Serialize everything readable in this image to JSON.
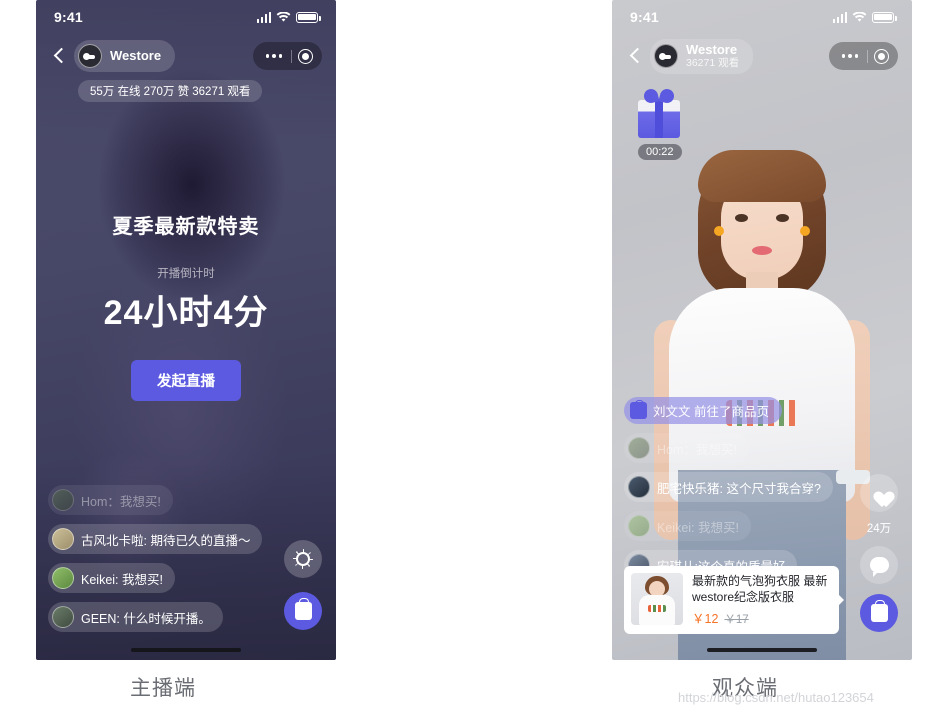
{
  "host": {
    "caption": "主播端",
    "status_bar": {
      "time": "9:41",
      "signal_icon": "signal-bars-icon",
      "wifi_icon": "wifi-icon",
      "battery_icon": "battery-icon"
    },
    "topbar": {
      "back_icon": "back-chevron-icon",
      "avatar_icon": "westore-avatar-icon",
      "store_name": "Westore",
      "more_icon": "more-dots-icon",
      "record_icon": "record-target-icon"
    },
    "stats_pill": "55万 在线  270万 赞  36271 观看",
    "center": {
      "title": "夏季最新款特卖",
      "countdown_label": "开播倒计时",
      "countdown_value": "24小时4分",
      "start_button": "发起直播"
    },
    "chat": [
      {
        "name": "Hom",
        "text": "Hom：我想买!",
        "faded": true
      },
      {
        "name": "古风北卡啦",
        "text": "古风北卡啦: 期待已久的直播～",
        "faded": false
      },
      {
        "name": "Keikei",
        "text": "Keikei: 我想买!",
        "faded": false
      },
      {
        "name": "GEEN",
        "text": "GEEN: 什么时候开播。",
        "faded": false
      }
    ],
    "rail": [
      {
        "icon": "gear-icon",
        "label": ""
      },
      {
        "icon": "shopping-bag-icon",
        "label": ""
      }
    ]
  },
  "viewer": {
    "caption": "观众端",
    "status_bar": {
      "time": "9:41",
      "signal_icon": "signal-bars-icon",
      "wifi_icon": "wifi-icon",
      "battery_icon": "battery-icon"
    },
    "topbar": {
      "back_icon": "back-chevron-icon",
      "avatar_icon": "westore-avatar-icon",
      "store_name": "Westore",
      "viewer_count": "36271 观看",
      "more_icon": "more-dots-icon",
      "record_icon": "record-target-icon"
    },
    "gift": {
      "icon": "gift-box-icon",
      "timer": "00:22"
    },
    "notice": {
      "icon": "purple-bag-icon",
      "text": "刘文文 前往了商品页"
    },
    "chat": [
      {
        "name": "Hom",
        "text": "Hom：我想买!",
        "faded": true
      },
      {
        "name": "肥宅快乐猪",
        "text": "肥宅快乐猪: 这个尺寸我合穿?",
        "faded": false
      },
      {
        "name": "Keikei",
        "text": "Keikei: 我想买!",
        "faded": true
      },
      {
        "name": "安琪儿",
        "text": "安琪儿:这个真的质量好",
        "faded": false
      }
    ],
    "rail": {
      "like_icon": "heart-icon",
      "like_count": "24万",
      "comment_icon": "comment-bubble-icon",
      "shop_icon": "shopping-bag-icon"
    },
    "product": {
      "thumb_icon": "product-thumbnail-icon",
      "name": "最新款的气泡狗衣服 最新westore纪念版衣服",
      "price": "￥12",
      "original_price": "￥17",
      "arrow_icon": "chevron-right-icon"
    }
  },
  "watermark": "https://blog.csdn.net/hutao123654",
  "colors": {
    "accent_purple": "#5b5ae0",
    "price_orange": "#f5742a",
    "host_bg": "#474767"
  }
}
